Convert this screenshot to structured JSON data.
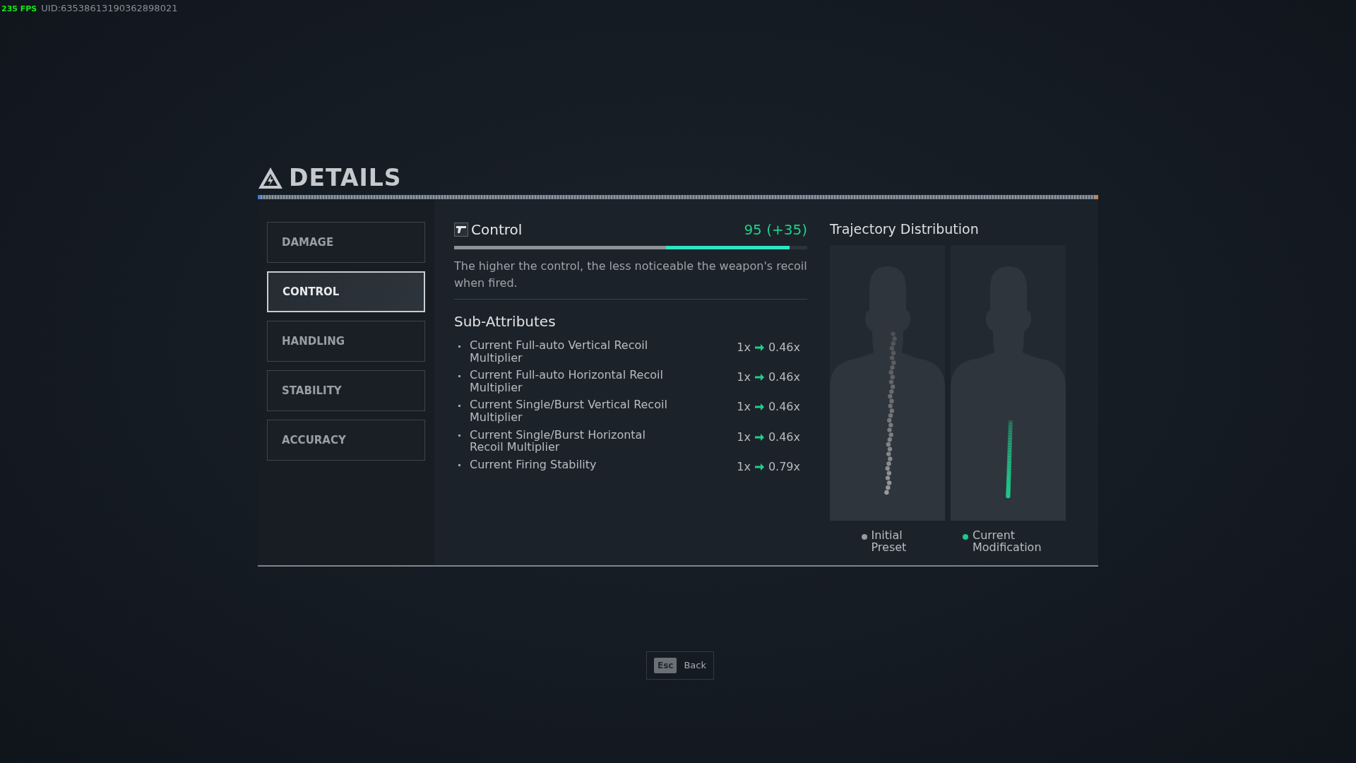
{
  "overlay": {
    "fps": "235 FPS",
    "uid": "UID:63538613190362898021"
  },
  "header": {
    "title": "DETAILS"
  },
  "tabs": [
    {
      "label": "DAMAGE",
      "selected": false
    },
    {
      "label": "CONTROL",
      "selected": true
    },
    {
      "label": "HANDLING",
      "selected": false
    },
    {
      "label": "STABILITY",
      "selected": false
    },
    {
      "label": "ACCURACY",
      "selected": false
    }
  ],
  "attribute": {
    "name": "Control",
    "value": "95 (+35)",
    "bar": [
      {
        "kind": "bonus",
        "level": 0.95
      },
      {
        "kind": "base",
        "level": 0.6
      }
    ],
    "description": "The higher the control, the less noticeable the weapon's recoil when fired."
  },
  "sub_attributes": {
    "title": "Sub-Attributes",
    "items": [
      {
        "name": "Current Full-auto Vertical Recoil Multiplier",
        "from": "1x",
        "to": "0.46x"
      },
      {
        "name": "Current Full-auto Horizontal Recoil Multiplier",
        "from": "1x",
        "to": "0.46x"
      },
      {
        "name": "Current Single/Burst Vertical Recoil Multiplier",
        "from": "1x",
        "to": "0.46x"
      },
      {
        "name": "Current Single/Burst Horizontal Recoil Multiplier",
        "from": "1x",
        "to": "0.46x"
      },
      {
        "name": "Current Firing Stability",
        "from": "1x",
        "to": "0.79x"
      }
    ]
  },
  "trajectory": {
    "title": "Trajectory Distribution",
    "legend": [
      {
        "label": "Initial Preset",
        "color": "#9a9a9a",
        "kind": "spread"
      },
      {
        "label": "Current Modification",
        "color": "#1fc88a",
        "kind": "tight"
      }
    ]
  },
  "footer": {
    "key": "Esc",
    "label": "Back"
  }
}
